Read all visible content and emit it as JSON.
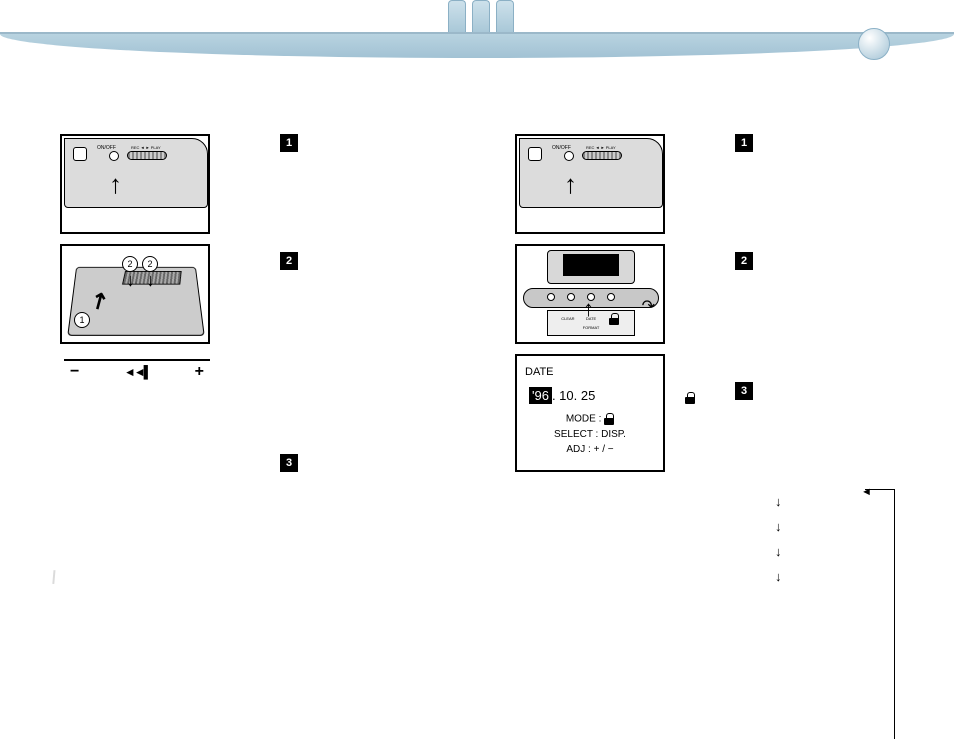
{
  "numbers": {
    "n1": "1",
    "n2": "2",
    "n3": "3"
  },
  "left": {
    "fig1": {
      "onoff": "ON/OFF",
      "slab": "REC ◄ ► PLAY"
    },
    "fig2": {
      "c1": "1",
      "c2": "2",
      "c3": "2"
    },
    "bar": {
      "minus": "−",
      "rewind": "◄◄▌",
      "plus": "+"
    }
  },
  "right": {
    "fig1": {
      "onoff": "ON/OFF",
      "slab": "REC ◄ ► PLAY"
    },
    "fig2": {
      "panel1": "CLEAR",
      "panel2": "DATE",
      "panel3": "",
      "panel4": "FORMAT"
    },
    "datebox": {
      "title": "DATE",
      "year": "'96",
      "rest": ".  10.  25",
      "mode_label": "MODE : ",
      "select": "SELECT : DISP.",
      "adj": "ADJ : + / −"
    },
    "flow": {
      "a": "↓",
      "b": "↓",
      "c": "↓",
      "d": "↓"
    }
  }
}
